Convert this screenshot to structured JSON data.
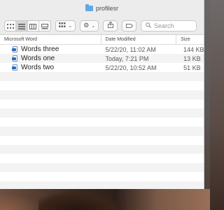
{
  "window": {
    "title": "profilesr"
  },
  "toolbar": {
    "view_icons": [
      "grid-view-icon",
      "list-view-icon",
      "column-view-icon",
      "gallery-view-icon"
    ],
    "group_icon": "group-icon",
    "action_icon": "gear-icon",
    "share_icon": "share-icon",
    "tag_icon": "tag-icon",
    "search_placeholder": "Search"
  },
  "table": {
    "columns": [
      "Microsoft Word",
      "Date Modified",
      "Size"
    ],
    "rows": [
      {
        "name": "Words three",
        "date": "5/22/20, 11:02 AM",
        "size": "144 KB"
      },
      {
        "name": "Words one",
        "date": "Today, 7:21 PM",
        "size": "13 KB"
      },
      {
        "name": "Words two",
        "date": "5/22/20, 10:52 AM",
        "size": "51 KB"
      }
    ]
  }
}
